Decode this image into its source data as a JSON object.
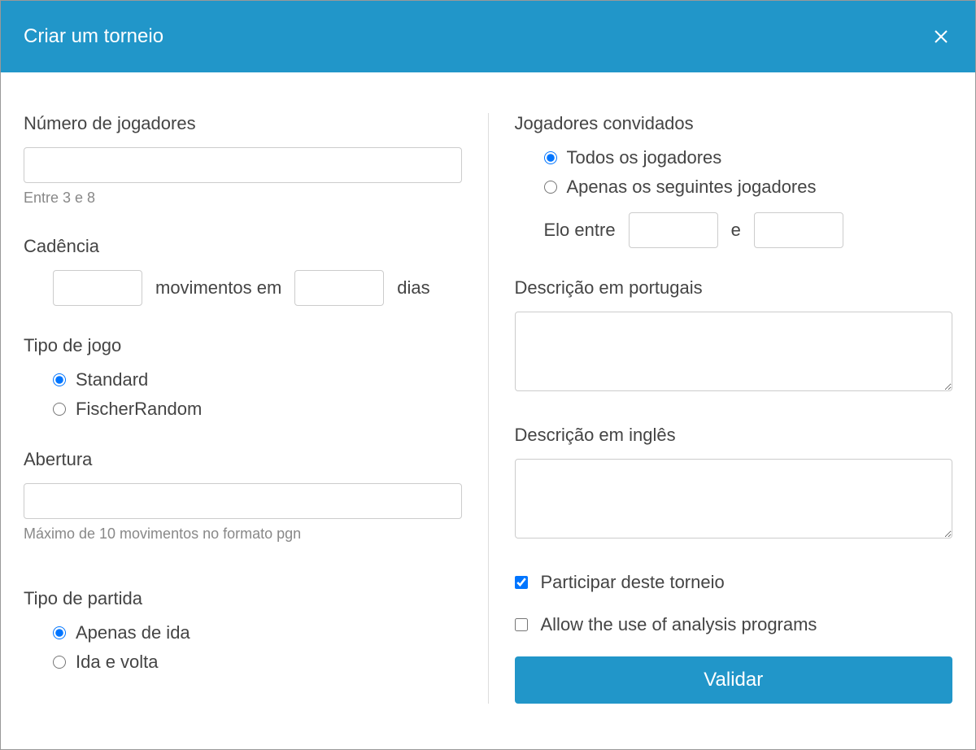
{
  "header": {
    "title": "Criar um torneio"
  },
  "left": {
    "numPlayers": {
      "label": "Número de jogadores",
      "value": "",
      "hint": "Entre 3 e 8"
    },
    "cadence": {
      "label": "Cadência",
      "movesValue": "",
      "movesText": "movimentos em",
      "daysValue": "",
      "daysText": "dias"
    },
    "gameType": {
      "label": "Tipo de jogo",
      "options": {
        "standard": "Standard",
        "fischer": "FischerRandom"
      }
    },
    "opening": {
      "label": "Abertura",
      "value": "",
      "hint": "Máximo de 10 movimentos no formato pgn"
    },
    "matchType": {
      "label": "Tipo de partida",
      "options": {
        "oneway": "Apenas de ida",
        "roundtrip": "Ida e volta"
      }
    }
  },
  "right": {
    "invited": {
      "label": "Jogadores convidados",
      "options": {
        "all": "Todos os jogadores",
        "only": "Apenas os seguintes jogadores"
      }
    },
    "elo": {
      "label": "Elo entre",
      "and": "e",
      "minValue": "",
      "maxValue": ""
    },
    "descPt": {
      "label": "Descrição em portugais",
      "value": ""
    },
    "descEn": {
      "label": "Descrição em inglês",
      "value": ""
    },
    "participate": {
      "label": "Participar deste torneio"
    },
    "allowAnalysis": {
      "label": "Allow the use of analysis programs"
    },
    "submit": {
      "label": "Validar"
    }
  }
}
